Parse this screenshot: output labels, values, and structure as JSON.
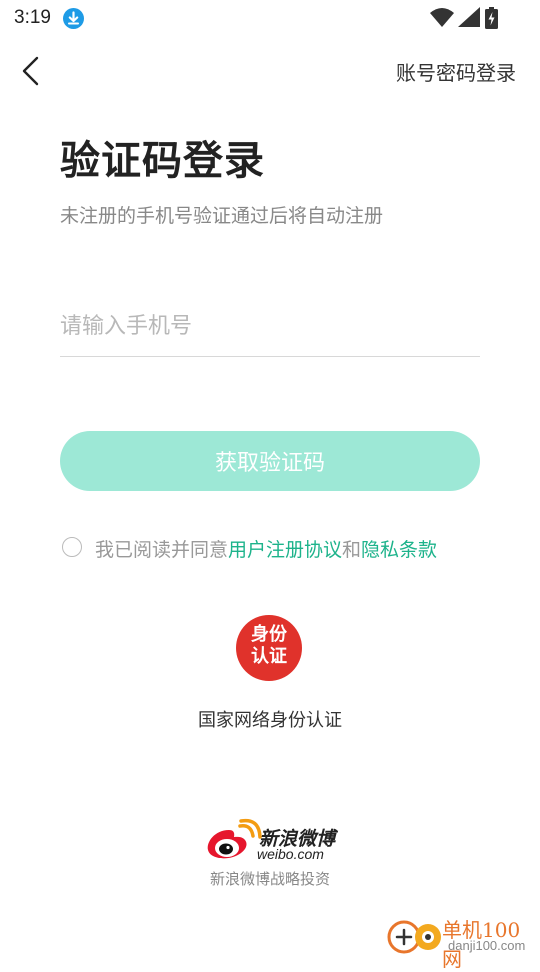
{
  "status_bar": {
    "time": "3:19",
    "download_icon": "download-icon",
    "wifi_icon": "wifi-icon",
    "signal_icon": "signal-icon",
    "battery_icon": "battery-charging-icon"
  },
  "header": {
    "back_icon": "chevron-left-icon",
    "password_login_label": "账号密码登录"
  },
  "main": {
    "title": "验证码登录",
    "subtitle": "未注册的手机号验证通过后将自动注册",
    "phone_placeholder": "请输入手机号",
    "phone_value": "",
    "get_code_label": "获取验证码"
  },
  "agreement": {
    "checked": false,
    "prefix": "我已阅读并同意",
    "user_agreement": "用户注册协议",
    "and": "和",
    "privacy": "隐私条款"
  },
  "id_auth": {
    "badge_text_line1": "身份",
    "badge_text_line2": "认证",
    "label": "国家网络身份认证"
  },
  "weibo": {
    "brand_cn": "新浪微博",
    "brand_en": "weibo.com",
    "investment": "新浪微博战略投资"
  },
  "watermark": {
    "name": "单机100网",
    "url": "danji100.com"
  },
  "colors": {
    "accent": "#1db38b",
    "button_disabled": "#9de8d6",
    "badge_red": "#e0322b",
    "download_blue": "#1e9be6"
  }
}
